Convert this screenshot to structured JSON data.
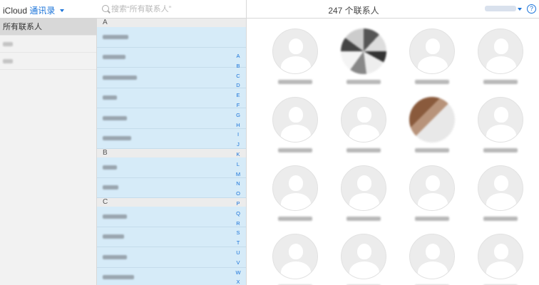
{
  "header": {
    "brand": "iCloud",
    "app_name": "通讯录",
    "search_placeholder": "搜索“所有联系人”",
    "contact_count_title": "247 个联系人",
    "help_symbol": "?"
  },
  "groups": {
    "items": [
      {
        "label": "所有联系人",
        "selected": true
      },
      {
        "label": "",
        "selected": false
      },
      {
        "label": "",
        "selected": false
      }
    ]
  },
  "contact_list": {
    "sections": [
      {
        "letter": "A",
        "rows": 6
      },
      {
        "letter": "B",
        "rows": 2
      },
      {
        "letter": "C",
        "rows": 4
      }
    ]
  },
  "index_letters": [
    "A",
    "B",
    "C",
    "D",
    "E",
    "F",
    "G",
    "H",
    "I",
    "J",
    "K",
    "L",
    "M",
    "N",
    "O",
    "P",
    "Q",
    "R",
    "S",
    "T",
    "U",
    "V",
    "W",
    "X"
  ],
  "grid": {
    "rows": 4,
    "columns": 4,
    "photo_cards": [
      "r0c1",
      "r1c2"
    ]
  }
}
